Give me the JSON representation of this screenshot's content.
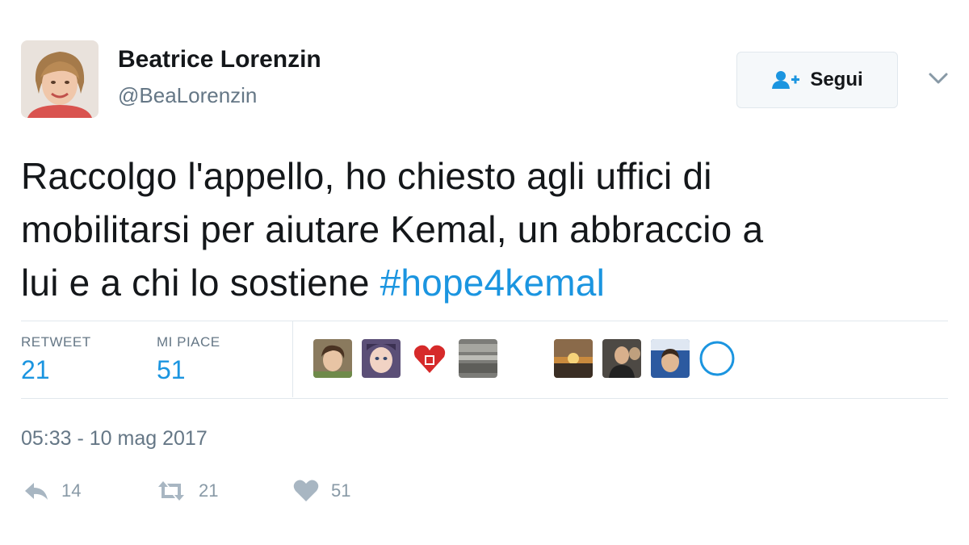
{
  "author": {
    "name": "Beatrice Lorenzin",
    "handle": "@BeaLorenzin",
    "avatar_icon": "profile-photo"
  },
  "follow_button": {
    "label": "Segui",
    "icon": "add-user-icon",
    "accent": "#1b95e0"
  },
  "menu": {
    "icon": "chevron-down-icon"
  },
  "tweet": {
    "lines": [
      "Raccolgo l'appello, ho chiesto agli uffici di",
      "mobilitarsi per aiutare Kemal, un abbraccio a",
      "lui e a chi lo sostiene "
    ],
    "hashtag": "#hope4kemal"
  },
  "stats": {
    "retweet_label": "RETWEET",
    "retweet_count": "21",
    "likes_label": "MI PIACE",
    "likes_count": "51"
  },
  "likers": [
    "liker-avatar-1",
    "liker-avatar-2",
    "liker-avatar-3",
    "liker-avatar-4",
    "liker-avatar-5",
    "liker-avatar-6",
    "liker-avatar-7",
    "liker-avatar-8"
  ],
  "timestamp": "05:33 - 10 mag 2017",
  "actions": {
    "reply_count": "14",
    "retweet_count": "21",
    "like_count": "51"
  },
  "colors": {
    "text": "#14171a",
    "secondary": "#657786",
    "link": "#1b95e0",
    "action_icon": "#a8b6c2"
  }
}
